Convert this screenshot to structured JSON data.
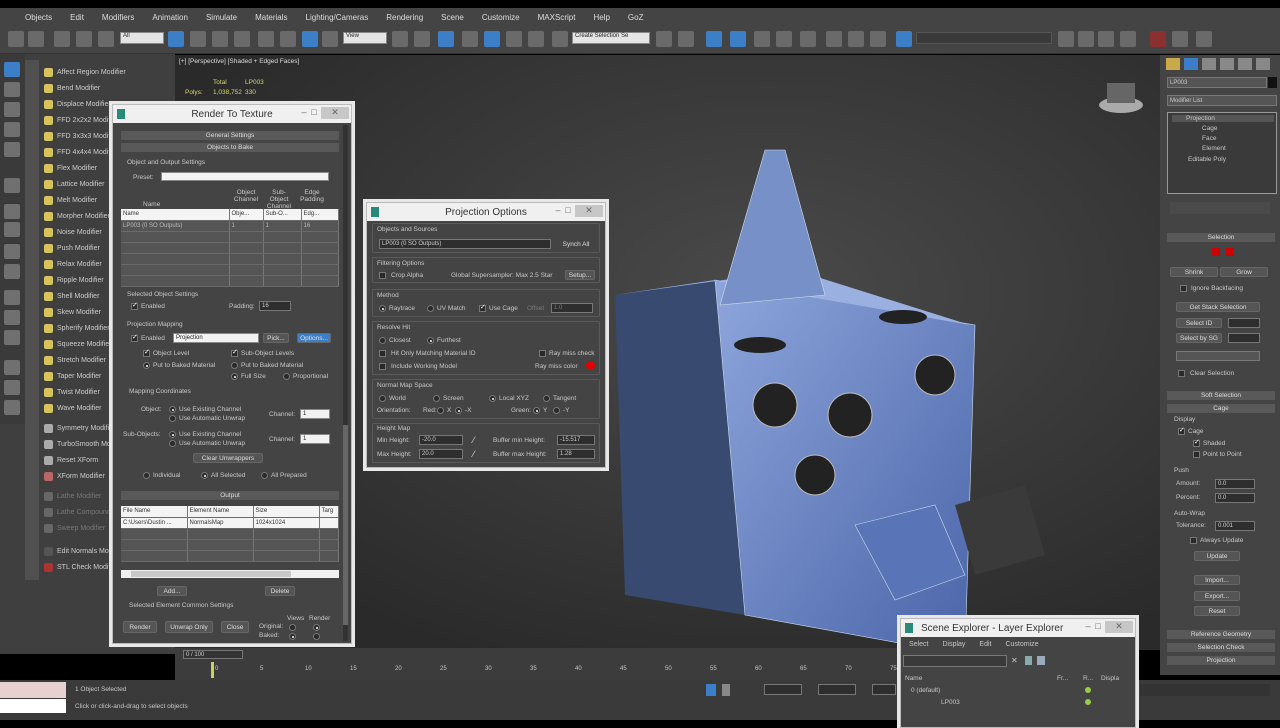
{
  "menu": [
    "Objects",
    "Edit",
    "Modifiers",
    "Animation",
    "Simulate",
    "Materials",
    "Lighting/Cameras",
    "Rendering",
    "Scene",
    "Customize",
    "MAXScript",
    "Help",
    "GoZ"
  ],
  "toolbar": {
    "selection_filter": "All",
    "ref_coord": "View",
    "named_selection": "Create Selection Se"
  },
  "modifiers": [
    "Affect Region Modifier",
    "Bend Modifier",
    "Displace Modifier",
    "FFD 2x2x2 Modifier",
    "FFD 3x3x3 Modifier",
    "FFD 4x4x4 Modifier",
    "Flex Modifier",
    "Lattice Modifier",
    "Melt Modifier",
    "Morpher Modifier",
    "Noise Modifier",
    "Push Modifier",
    "Relax Modifier",
    "Ripple Modifier",
    "Shell Modifier",
    "Skew Modifier",
    "Spherify Modifier",
    "Squeeze Modifier",
    "Stretch Modifier",
    "Taper Modifier",
    "Twist Modifier",
    "Wave Modifier",
    "Symmetry Modifier",
    "TurboSmooth Modifier",
    "Reset XForm",
    "XForm Modifier",
    "Lathe Modifier",
    "Lathe Compound",
    "Sweep Modifier",
    "Edit Normals Modifier",
    "STL Check Modifier"
  ],
  "viewport": {
    "label": "[+] [Perspective] [Shaded + Edged Faces]",
    "stats_total": "Total",
    "stats_obj": "LP003",
    "stats_polys": "Polys:",
    "stats_total_val": "1,038,752",
    "stats_obj_val": "330"
  },
  "rtt": {
    "title": "Render To Texture",
    "general": "General Settings",
    "objects": "Objects to Bake",
    "obj_out": "Object and Output Settings",
    "preset": "Preset:",
    "col_top": [
      "Name",
      "Object Channel",
      "Sub-Object Channel",
      "Edge Padding"
    ],
    "cols": [
      "Name",
      "Obje...",
      "Sub-O...",
      "Edg..."
    ],
    "row": [
      "LP003 (0 SO Outputs)",
      "1",
      "1",
      "16"
    ],
    "sel_obj": "Selected Object Settings",
    "enabled": "Enabled",
    "padding": "Padding:",
    "padding_val": "16",
    "proj_map": "Projection Mapping",
    "proj_enabled": "Enabled",
    "proj_mod": "Projection",
    "pick": "Pick...",
    "options": "Options...",
    "object_level": "Object Level",
    "sub_object": "Sub-Object Levels",
    "put_baked": "Put to Baked Material",
    "put_baked2": "Put to Baked Material",
    "full_size": "Full Size",
    "proportional": "Proportional",
    "map_coords": "Mapping Coordinates",
    "object": "Object:",
    "use_existing": "Use Existing Channel",
    "use_auto": "Use Automatic Unwrap",
    "channel": "Channel:",
    "channel_val": "1",
    "sub_objects": "Sub-Objects:",
    "use_existing2": "Use Existing Channel",
    "use_auto2": "Use Automatic Unwrap",
    "channel_val2": "1",
    "clear_unwrap": "Clear Unwrappers",
    "individual": "Individual",
    "all_selected": "All Selected",
    "all_prepared": "All Prepared",
    "output": "Output",
    "out_cols": [
      "File Name",
      "Element Name",
      "Size",
      "Targ"
    ],
    "out_row": [
      "C:\\Users\\Dustin ...",
      "NormalsMap",
      "1024x1024",
      ""
    ],
    "add": "Add...",
    "delete": "Delete",
    "sel_elem": "Selected Element Common Settings",
    "render": "Render",
    "unwrap_only": "Unwrap Only",
    "close": "Close",
    "views": "Views",
    "render_col": "Render",
    "original": "Original:",
    "baked": "Baked:"
  },
  "proj": {
    "title": "Projection Options",
    "obj_src": "Objects and Sources",
    "obj_field": "LP003 (0 SO Outputs)",
    "synch": "Synch All",
    "filter": "Filtering Options",
    "crop_alpha": "Crop Alpha",
    "supersampler": "Global Supersampler: Max 2.5 Star",
    "setup": "Setup...",
    "method": "Method",
    "raytrace": "Raytrace",
    "uv_match": "UV Match",
    "use_cage": "Use Cage",
    "offset": "Offset",
    "offset_val": "1.0",
    "resolve": "Resolve Hit",
    "closest": "Closest",
    "furthest": "Furthest",
    "hit_only": "Hit Only Matching Material ID",
    "ray_miss": "Ray miss check",
    "include": "Include Working Model",
    "ray_miss_color": "Ray miss color",
    "nm_space": "Normal Map Space",
    "world": "World",
    "screen": "Screen",
    "local": "Local XYZ",
    "tangent": "Tangent",
    "orientation": "Orientation:",
    "red": "Red:",
    "green": "Green:",
    "x": "X",
    "nx": "-X",
    "y": "Y",
    "ny": "-Y",
    "height": "Height Map",
    "min_h": "Min Height:",
    "min_val": "-20.0",
    "max_h": "Max Height:",
    "max_val": "20.0",
    "buf_min": "Buffer min Height:",
    "buf_min_val": "-15.517",
    "buf_max": "Buffer max Height:",
    "buf_max_val": "1.28",
    "miss_color": "#e00000"
  },
  "right": {
    "obj_name": "LP003",
    "modlist": "Modifier List",
    "stack": [
      "Projection",
      "Cage",
      "Face",
      "Element",
      "Editable Poly"
    ],
    "selection": "Selection",
    "shrink": "Shrink",
    "grow": "Grow",
    "ignore_bf": "Ignore Backfacing",
    "get_stack": "Get Stack Selection",
    "select_id": "Select ID",
    "select_smg": "Select by SG",
    "clear_sel": "Clear Selection",
    "soft": "Soft Selection",
    "cage": "Cage",
    "display": "Display",
    "cage_cb": "Cage",
    "shaded": "Shaded",
    "point_to_point": "Point to Point",
    "push": "Push",
    "amount": "Amount:",
    "amount_val": "0.0",
    "percent": "Percent:",
    "percent_val": "0.0",
    "autowrap": "Auto-Wrap",
    "tolerance": "Tolerance:",
    "tolerance_val": "0.001",
    "always_update": "Always Update",
    "update": "Update",
    "import": "Import...",
    "export": "Export...",
    "reset": "Reset",
    "ref_geo": "Reference Geometry",
    "sel_check": "Selection Check",
    "projection": "Projection"
  },
  "scene": {
    "title": "Scene Explorer - Layer Explorer",
    "menu": [
      "Select",
      "Display",
      "Edit",
      "Customize"
    ],
    "cols": [
      "Name",
      "Fr...",
      "R...",
      "Displa"
    ],
    "rows": [
      "0 (default)",
      "LP003"
    ]
  },
  "timeline": {
    "frame": "0 / 100",
    "ticks": [
      "0",
      "5",
      "10",
      "15",
      "20",
      "25",
      "30",
      "35",
      "40",
      "45",
      "50",
      "55",
      "60",
      "65",
      "70",
      "75"
    ]
  },
  "status": {
    "selected": "1 Object Selected",
    "prompt": "Click or click-and-drag to select objects"
  }
}
